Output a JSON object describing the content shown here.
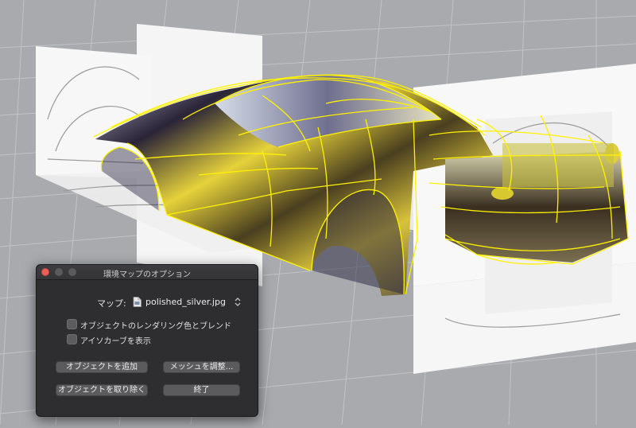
{
  "dialog": {
    "title": "環境マップのオプション",
    "map_label": "マップ:",
    "map_value": "polished_silver.jpg",
    "checkboxes": [
      {
        "label": "オブジェクトのレンダリング色とブレンド",
        "checked": false
      },
      {
        "label": "アイソカーブを表示",
        "checked": false
      }
    ],
    "buttons": {
      "add_object": "オブジェクトを追加",
      "adjust_mesh": "メッシュを調整...",
      "remove_object": "オブジェクトを取り除く",
      "done": "終了"
    }
  },
  "colors": {
    "viewport_bg": "#a9aaad",
    "grid": "#c7c8cb",
    "wireframe": "#fff200",
    "dialog_bg": "#2e2e30",
    "button_bg": "#5b5b5e",
    "close_button": "#ec5f57"
  },
  "icons": [
    "document-icon",
    "stepper-icon",
    "close-icon"
  ]
}
